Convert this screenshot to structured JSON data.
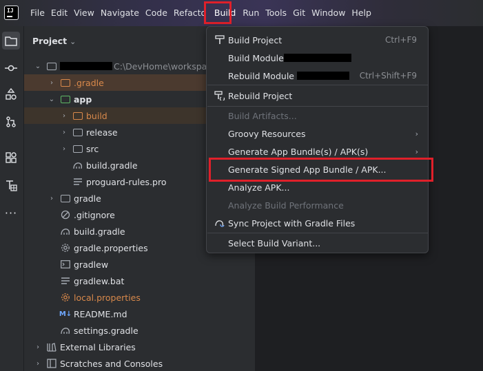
{
  "menubar": {
    "items": [
      {
        "label": "File"
      },
      {
        "label": "Edit"
      },
      {
        "label": "View"
      },
      {
        "label": "Navigate"
      },
      {
        "label": "Code"
      },
      {
        "label": "Refacto"
      },
      {
        "label": "Build"
      },
      {
        "label": "Run"
      },
      {
        "label": "Tools"
      },
      {
        "label": "Git"
      },
      {
        "label": "Window"
      },
      {
        "label": "Help"
      }
    ]
  },
  "project_panel": {
    "title": "Project",
    "root_path": "C:\\DevHome\\workspac",
    "tree": [
      {
        "label": ".gradle",
        "style": "orange"
      },
      {
        "label": "app",
        "style": "bold"
      },
      {
        "label": "build",
        "style": "orange"
      },
      {
        "label": "release",
        "style": "normal"
      },
      {
        "label": "src",
        "style": "normal"
      },
      {
        "label": "build.gradle",
        "style": "normal"
      },
      {
        "label": "proguard-rules.pro",
        "style": "normal"
      },
      {
        "label": "gradle",
        "style": "normal"
      },
      {
        "label": ".gitignore",
        "style": "normal"
      },
      {
        "label": "build.gradle",
        "style": "normal"
      },
      {
        "label": "gradle.properties",
        "style": "normal"
      },
      {
        "label": "gradlew",
        "style": "normal"
      },
      {
        "label": "gradlew.bat",
        "style": "normal"
      },
      {
        "label": "local.properties",
        "style": "orange"
      },
      {
        "label": "README.md",
        "style": "normal"
      },
      {
        "label": "settings.gradle",
        "style": "normal"
      },
      {
        "label": "External Libraries",
        "style": "normal"
      },
      {
        "label": "Scratches and Consoles",
        "style": "normal"
      }
    ]
  },
  "build_menu": {
    "items": [
      {
        "label": "Build Project",
        "shortcut": "Ctrl+F9"
      },
      {
        "label": "Build Module",
        "shortcut": ""
      },
      {
        "label": "Rebuild Module",
        "shortcut": "Ctrl+Shift+F9"
      },
      {
        "label": "Rebuild Project",
        "shortcut": ""
      },
      {
        "label": "Build Artifacts...",
        "shortcut": ""
      },
      {
        "label": "Groovy Resources",
        "shortcut": ""
      },
      {
        "label": "Generate App Bundle(s) / APK(s)",
        "shortcut": ""
      },
      {
        "label": "Generate Signed App Bundle / APK...",
        "shortcut": ""
      },
      {
        "label": "Analyze APK...",
        "shortcut": ""
      },
      {
        "label": "Analyze Build Performance",
        "shortcut": ""
      },
      {
        "label": "Sync Project with Gradle Files",
        "shortcut": ""
      },
      {
        "label": "Select Build Variant...",
        "shortcut": ""
      }
    ]
  },
  "colors": {
    "highlight_box": "#e0202a",
    "orange_text": "#d9894b",
    "background": "#1e1f22",
    "panel": "#2b2d30"
  }
}
